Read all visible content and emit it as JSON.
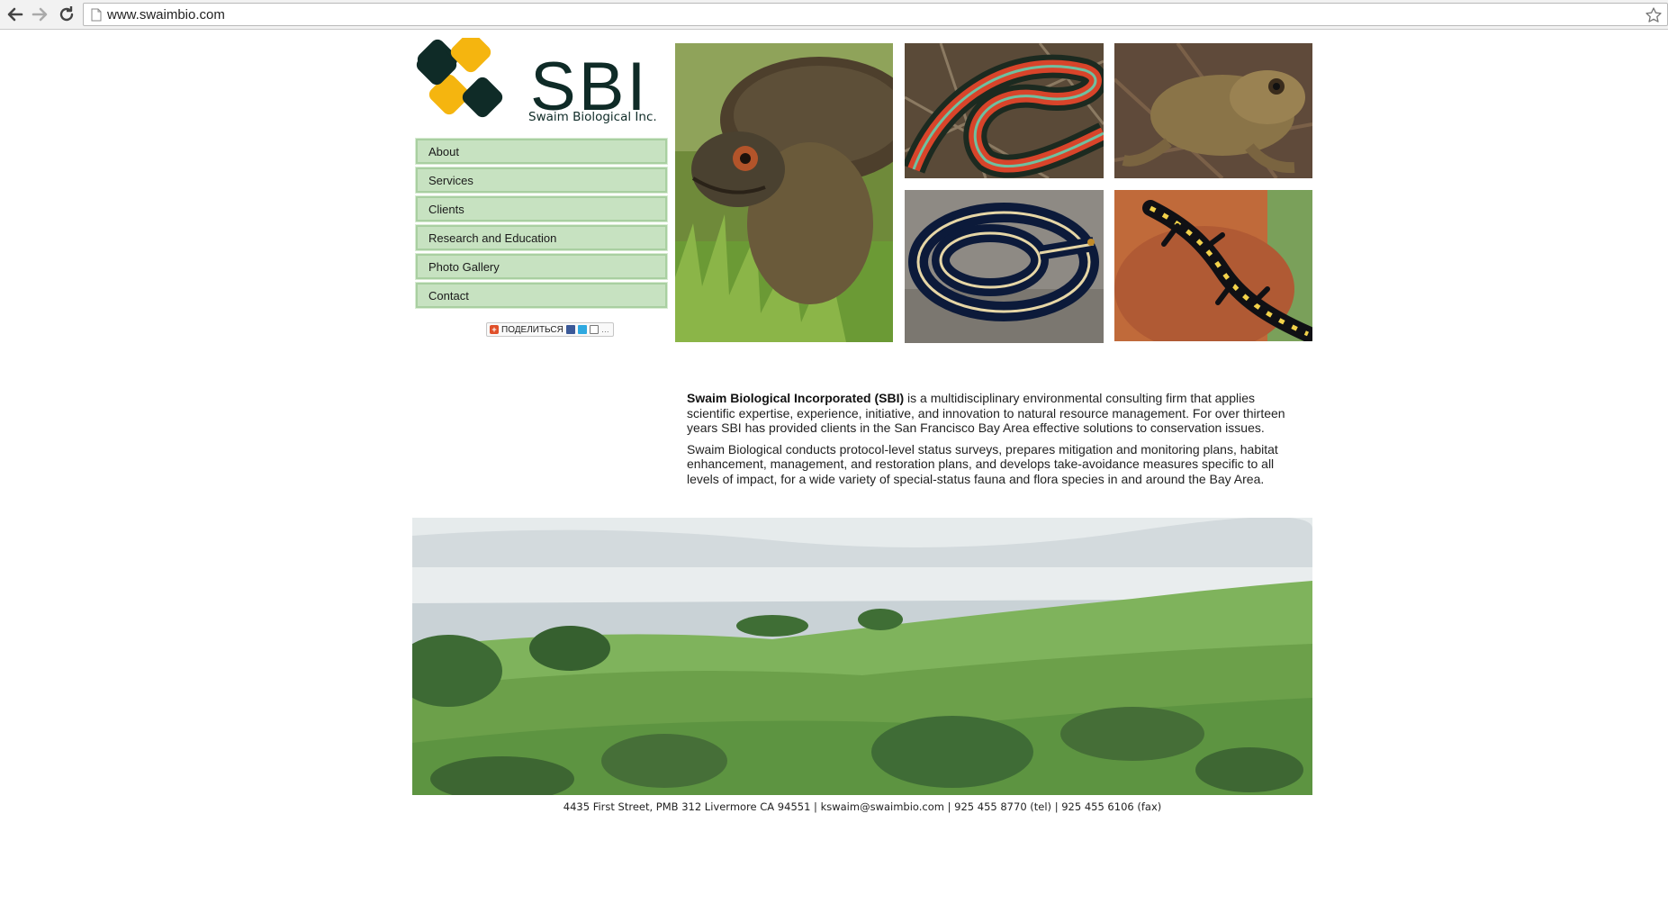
{
  "browser": {
    "url": "www.swaimbio.com",
    "back_icon": "back-arrow-icon",
    "forward_icon": "forward-arrow-icon",
    "reload_icon": "reload-icon",
    "star_icon": "star-icon"
  },
  "logo": {
    "wordmark": "SBI",
    "tagline": "Swaim Biological Inc.",
    "colors": {
      "dark": "#0f2b27",
      "accent": "#f5b50f"
    }
  },
  "menu": {
    "items": [
      {
        "label": "About"
      },
      {
        "label": "Services"
      },
      {
        "label": "Clients"
      },
      {
        "label": "Research and Education"
      },
      {
        "label": "Photo Gallery"
      },
      {
        "label": "Contact"
      }
    ],
    "colors": {
      "fill": "#c7e2c1",
      "border": "#a9cfa1"
    }
  },
  "share": {
    "label": "ПОДЕЛИТЬСЯ"
  },
  "photos": {
    "items": [
      {
        "subject": "turtle"
      },
      {
        "subject": "garter snake"
      },
      {
        "subject": "frog"
      },
      {
        "subject": "striped snake"
      },
      {
        "subject": "salamander"
      },
      {
        "subject": "bay area landscape"
      }
    ]
  },
  "intro": {
    "p1_bold": "Swaim Biological Incorporated (SBI)",
    "p1_rest": " is a multidisciplinary environmental consulting firm that applies scientific expertise, experience, initiative, and innovation to natural resource management. For over thirteen years SBI has provided clients in the San Francisco Bay Area effective solutions to conservation issues.",
    "p2": "Swaim Biological conducts protocol-level status surveys, prepares mitigation and monitoring plans, habitat enhancement, management, and restoration plans, and develops take-avoidance measures specific to all levels of impact, for a wide variety of special-status fauna and flora species in and around the Bay Area."
  },
  "footer": {
    "text": "4435 First Street, PMB 312 Livermore CA 94551 | kswaim@swaimbio.com | 925 455 8770 (tel) | 925 455 6106 (fax)"
  }
}
